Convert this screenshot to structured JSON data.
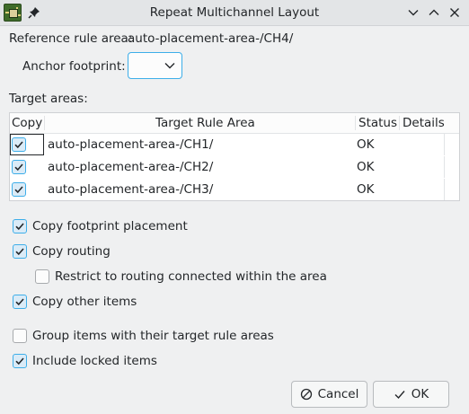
{
  "window": {
    "title": "Repeat Multichannel Layout"
  },
  "reference": {
    "label": "Reference rule area:",
    "value": "auto-placement-area-/CH4/"
  },
  "anchor": {
    "label": "Anchor footprint:",
    "selected": ""
  },
  "targets": {
    "label": "Target areas:",
    "columns": [
      "Copy",
      "Target Rule Area",
      "Status",
      "Details"
    ],
    "rows": [
      {
        "checked": true,
        "area": "auto-placement-area-/CH1/",
        "status": "OK",
        "details": ""
      },
      {
        "checked": true,
        "area": "auto-placement-area-/CH2/",
        "status": "OK",
        "details": ""
      },
      {
        "checked": true,
        "area": "auto-placement-area-/CH3/",
        "status": "OK",
        "details": ""
      }
    ]
  },
  "options": {
    "copy_footprint_placement": {
      "label": "Copy footprint placement",
      "checked": true
    },
    "copy_routing": {
      "label": "Copy routing",
      "checked": true
    },
    "restrict_routing": {
      "label": "Restrict to routing connected within the area",
      "checked": false
    },
    "copy_other_items": {
      "label": "Copy other items",
      "checked": true
    },
    "group_items": {
      "label": "Group items with their target rule areas",
      "checked": false
    },
    "include_locked": {
      "label": "Include locked items",
      "checked": true
    }
  },
  "buttons": {
    "cancel": "Cancel",
    "ok": "OK"
  },
  "colors": {
    "accent": "#3daee9",
    "window_bg": "#eff0f1",
    "check_fill": "#daebf7"
  }
}
